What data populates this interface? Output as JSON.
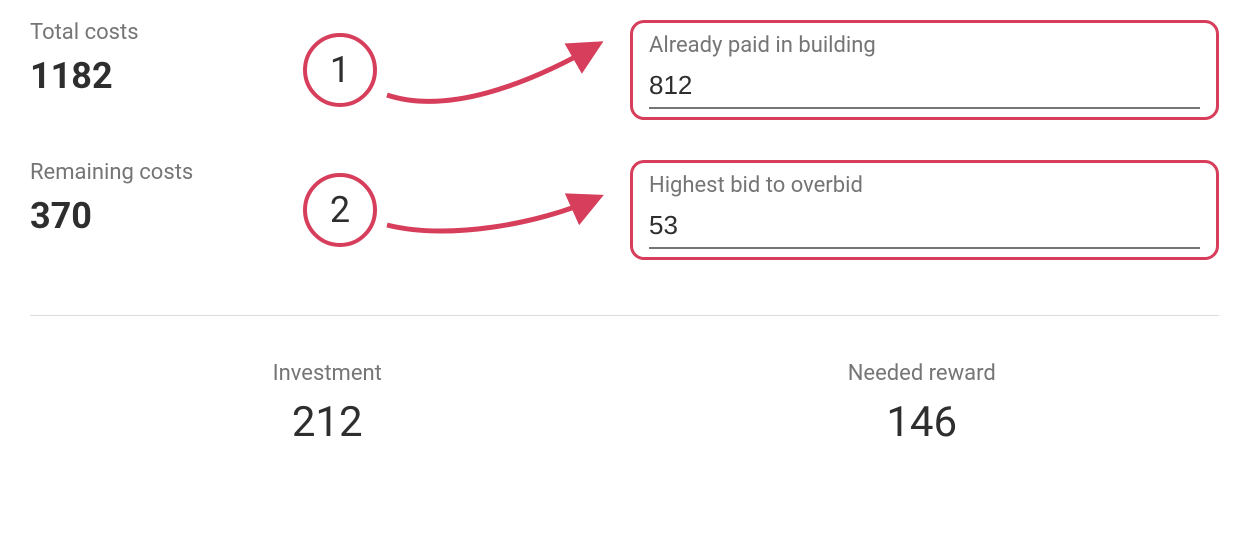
{
  "stats": {
    "total_costs_label": "Total costs",
    "total_costs_value": "1182",
    "remaining_costs_label": "Remaining costs",
    "remaining_costs_value": "370"
  },
  "inputs": {
    "already_paid_label": "Already paid in building",
    "already_paid_value": "812",
    "highest_bid_label": "Highest bid to overbid",
    "highest_bid_value": "53"
  },
  "annotations": {
    "one": "1",
    "two": "2"
  },
  "summary": {
    "investment_label": "Investment",
    "investment_value": "212",
    "needed_reward_label": "Needed reward",
    "needed_reward_value": "146"
  },
  "colors": {
    "accent": "#d63e5b",
    "muted": "#757575"
  }
}
